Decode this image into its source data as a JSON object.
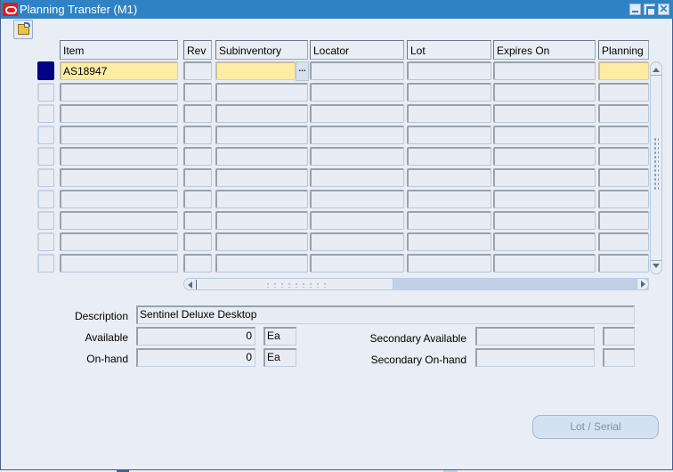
{
  "window": {
    "title": "Planning Transfer (M1)",
    "controls": [
      "minimize",
      "maximize",
      "close"
    ],
    "close_glyph": "✕"
  },
  "toolbar": {
    "open_folder_icon": "folder-open-icon"
  },
  "table": {
    "columns": [
      {
        "key": "item",
        "label": "Item"
      },
      {
        "key": "rev",
        "label": "Rev"
      },
      {
        "key": "subinventory",
        "label": "Subinventory"
      },
      {
        "key": "locator",
        "label": "Locator"
      },
      {
        "key": "lot",
        "label": "Lot"
      },
      {
        "key": "expires_on",
        "label": "Expires On"
      },
      {
        "key": "planning",
        "label": "Planning"
      }
    ],
    "rows": [
      {
        "item": "AS18947",
        "rev": "",
        "subinventory": "",
        "locator": "",
        "lot": "",
        "expires_on": "",
        "planning": "",
        "selected": true
      },
      {
        "item": "",
        "rev": "",
        "subinventory": "",
        "locator": "",
        "lot": "",
        "expires_on": "",
        "planning": ""
      },
      {
        "item": "",
        "rev": "",
        "subinventory": "",
        "locator": "",
        "lot": "",
        "expires_on": "",
        "planning": ""
      },
      {
        "item": "",
        "rev": "",
        "subinventory": "",
        "locator": "",
        "lot": "",
        "expires_on": "",
        "planning": ""
      },
      {
        "item": "",
        "rev": "",
        "subinventory": "",
        "locator": "",
        "lot": "",
        "expires_on": "",
        "planning": ""
      },
      {
        "item": "",
        "rev": "",
        "subinventory": "",
        "locator": "",
        "lot": "",
        "expires_on": "",
        "planning": ""
      },
      {
        "item": "",
        "rev": "",
        "subinventory": "",
        "locator": "",
        "lot": "",
        "expires_on": "",
        "planning": ""
      },
      {
        "item": "",
        "rev": "",
        "subinventory": "",
        "locator": "",
        "lot": "",
        "expires_on": "",
        "planning": ""
      },
      {
        "item": "",
        "rev": "",
        "subinventory": "",
        "locator": "",
        "lot": "",
        "expires_on": "",
        "planning": ""
      },
      {
        "item": "",
        "rev": "",
        "subinventory": "",
        "locator": "",
        "lot": "",
        "expires_on": "",
        "planning": ""
      }
    ],
    "lov_button_label": "..."
  },
  "details": {
    "description_label": "Description",
    "description_value": "Sentinel Deluxe Desktop",
    "available_label": "Available",
    "available_value": "0",
    "available_uom": "Ea",
    "onhand_label": "On-hand",
    "onhand_value": "0",
    "onhand_uom": "Ea",
    "secondary_available_label": "Secondary Available",
    "secondary_available_value": "",
    "secondary_available_uom": "",
    "secondary_onhand_label": "Secondary On-hand",
    "secondary_onhand_value": "",
    "secondary_onhand_uom": ""
  },
  "buttons": {
    "lot_serial": "Lot / Serial"
  },
  "colors": {
    "titlebar": "#2f82c3",
    "current_field": "#feeca4",
    "record_indicator": "#010284",
    "background": "#e9edf5"
  }
}
